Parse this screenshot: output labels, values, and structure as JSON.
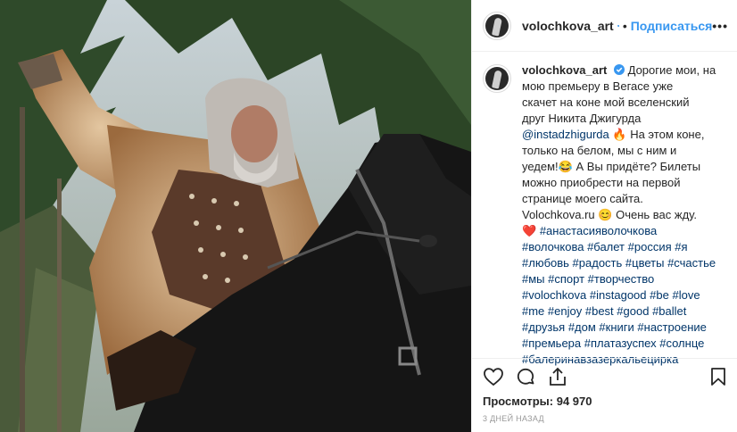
{
  "post": {
    "username": "volochkova_art",
    "follow_label": "Подписаться",
    "separator": "•",
    "more_label": "•••",
    "caption": {
      "username": "volochkova_art",
      "line1": "Дорогие мои, на",
      "line2": "мою премьеру в Вегасе уже",
      "line3": "скачет на коне мой вселенский",
      "line4": "друг Никита Джигурда",
      "mention": "@instadzhigurda",
      "fire_emoji": "🔥",
      "line5a": "На этом коне,",
      "line6": "только на белом, мы с ним и",
      "line7": "уедем!",
      "laugh_emoji": "😂",
      "line7b": "А Вы придёте? Билеты",
      "line8": "можно приобрести на первой",
      "line9": "странице моего сайта.",
      "line10": "Volochkova.ru",
      "smile_emoji": "😊",
      "line10b": "Очень вас жду.",
      "heart_emoji": "❤️",
      "hashtags": [
        "#анастасияволочкова",
        "#волочкова",
        "#балет",
        "#россия",
        "#я",
        "#любовь",
        "#радость",
        "#цветы",
        "#счастье",
        "#мы",
        "#спорт",
        "#творчество",
        "#volochkova",
        "#instagood",
        "#be",
        "#love",
        "#me",
        "#enjoy",
        "#best",
        "#good",
        "#ballet",
        "#друзья",
        "#дом",
        "#книги",
        "#настроение",
        "#премьера",
        "#платазуспех",
        "#солнце",
        "#балеринавзазеркальецирка"
      ]
    },
    "views_label": "Просмотры:",
    "views_count": "94 970",
    "time_ago": "3 дней назад"
  },
  "colors": {
    "link": "#3897f0",
    "hashtag": "#003569",
    "text": "#262626",
    "muted": "#999999",
    "border": "#efefef"
  },
  "icons": [
    "heart-icon",
    "comment-icon",
    "share-icon",
    "bookmark-icon",
    "verified-badge-icon"
  ]
}
